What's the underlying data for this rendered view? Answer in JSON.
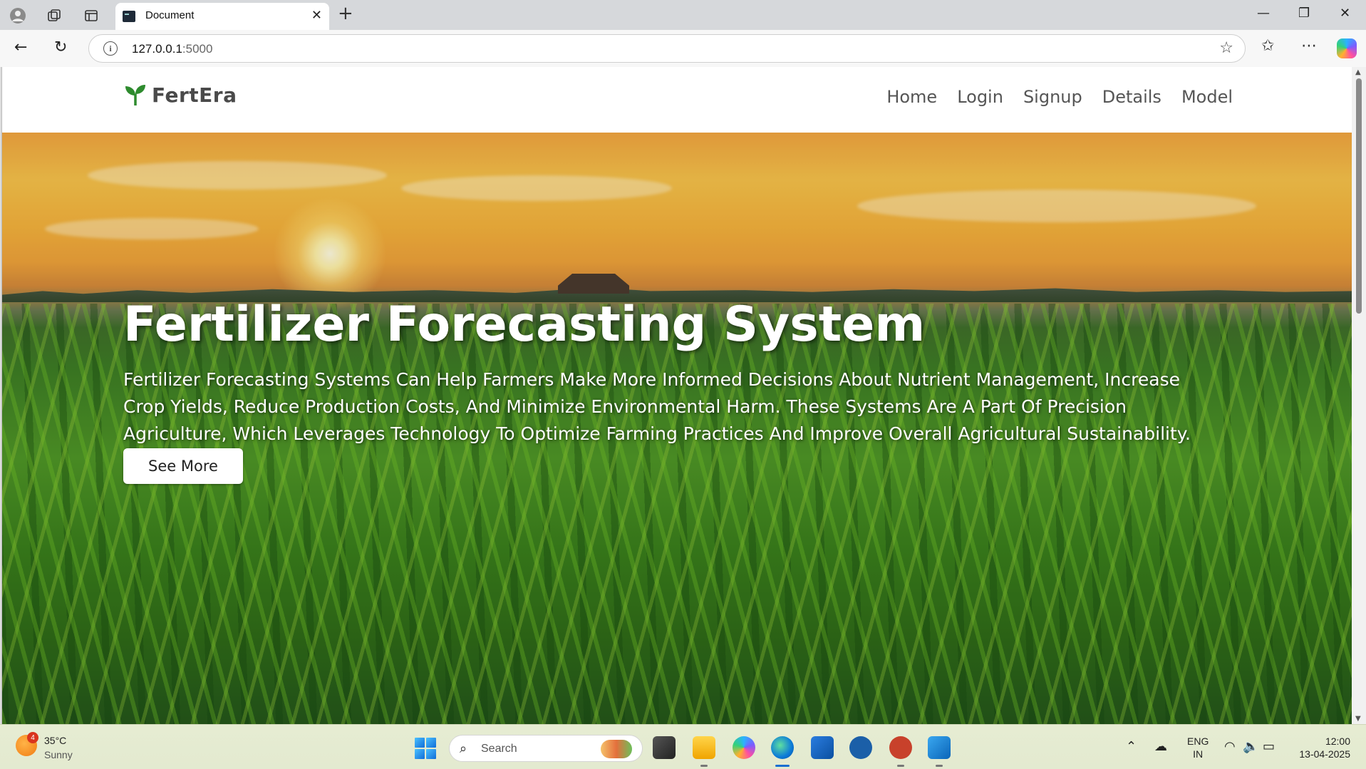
{
  "browser": {
    "tab_title": "Document",
    "url_host": "127.0.0.1",
    "url_port": ":5000"
  },
  "site": {
    "brand": "FertEra",
    "nav": [
      "Home",
      "Login",
      "Signup",
      "Details",
      "Model"
    ],
    "hero": {
      "title": "Fertilizer Forecasting System",
      "description": "Fertilizer Forecasting Systems Can Help Farmers Make More Informed Decisions About Nutrient Management, Increase Crop Yields, Reduce Production Costs, And Minimize Environmental Harm. These Systems Are A Part Of Precision Agriculture, Which Leverages Technology To Optimize Farming Practices And Improve Overall Agricultural Sustainability.",
      "button_label": "See More"
    },
    "colors": {
      "brand_green": "#2e8b2e"
    }
  },
  "taskbar": {
    "weather_badge": "4",
    "weather_temp": "35°C",
    "weather_condition": "Sunny",
    "search_placeholder": "Search",
    "lang_line1": "ENG",
    "lang_line2": "IN",
    "time": "12:00",
    "date": "13-04-2025"
  }
}
